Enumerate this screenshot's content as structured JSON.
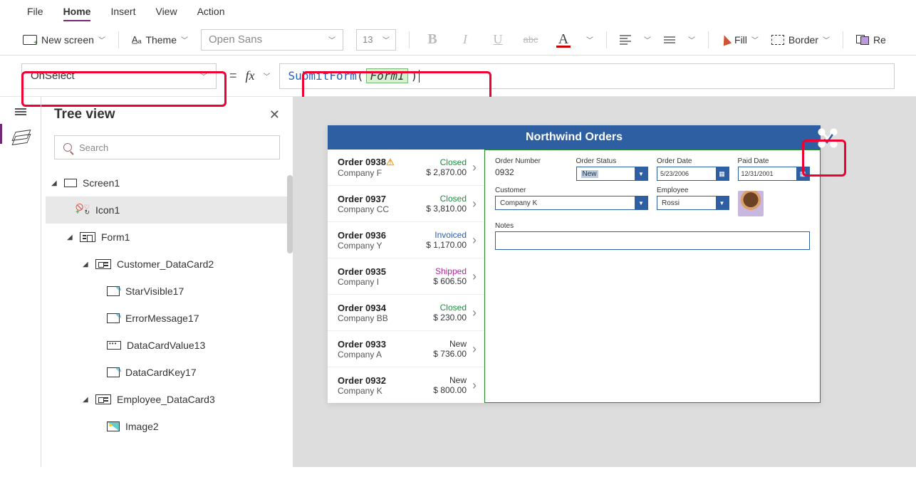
{
  "menu": {
    "file": "File",
    "home": "Home",
    "insert": "Insert",
    "view": "View",
    "action": "Action"
  },
  "ribbon": {
    "new_screen": "New screen",
    "theme": "Theme",
    "font": "Open Sans",
    "size": "13",
    "fill": "Fill",
    "border": "Border",
    "reorder": "Re"
  },
  "formula": {
    "property": "OnSelect",
    "fn": "SubmitForm",
    "arg": "Form1"
  },
  "treeview": {
    "title": "Tree view",
    "search_placeholder": "Search",
    "items": {
      "screen1": "Screen1",
      "icon1": "Icon1",
      "form1": "Form1",
      "customer_card": "Customer_DataCard2",
      "star": "StarVisible17",
      "error": "ErrorMessage17",
      "value": "DataCardValue13",
      "key": "DataCardKey17",
      "employee_card": "Employee_DataCard3",
      "image2": "Image2"
    }
  },
  "app": {
    "title": "Northwind Orders",
    "gallery": [
      {
        "order": "Order 0938",
        "company": "Company F",
        "status": "Closed",
        "status_cls": "closed",
        "amount": "$ 2,870.00",
        "warn": true
      },
      {
        "order": "Order 0937",
        "company": "Company CC",
        "status": "Closed",
        "status_cls": "closed",
        "amount": "$ 3,810.00"
      },
      {
        "order": "Order 0936",
        "company": "Company Y",
        "status": "Invoiced",
        "status_cls": "invoiced",
        "amount": "$ 1,170.00"
      },
      {
        "order": "Order 0935",
        "company": "Company I",
        "status": "Shipped",
        "status_cls": "shipped",
        "amount": "$ 606.50"
      },
      {
        "order": "Order 0934",
        "company": "Company BB",
        "status": "Closed",
        "status_cls": "closed",
        "amount": "$ 230.00"
      },
      {
        "order": "Order 0933",
        "company": "Company A",
        "status": "New",
        "status_cls": "new",
        "amount": "$ 736.00"
      },
      {
        "order": "Order 0932",
        "company": "Company K",
        "status": "New",
        "status_cls": "new",
        "amount": "$ 800.00"
      }
    ],
    "form": {
      "order_number_lbl": "Order Number",
      "order_number": "0932",
      "order_status_lbl": "Order Status",
      "order_status": "New",
      "order_date_lbl": "Order Date",
      "order_date": "5/23/2006",
      "paid_date_lbl": "Paid Date",
      "paid_date": "12/31/2001",
      "customer_lbl": "Customer",
      "customer": "Company K",
      "employee_lbl": "Employee",
      "employee": "Rossi",
      "notes_lbl": "Notes"
    }
  }
}
